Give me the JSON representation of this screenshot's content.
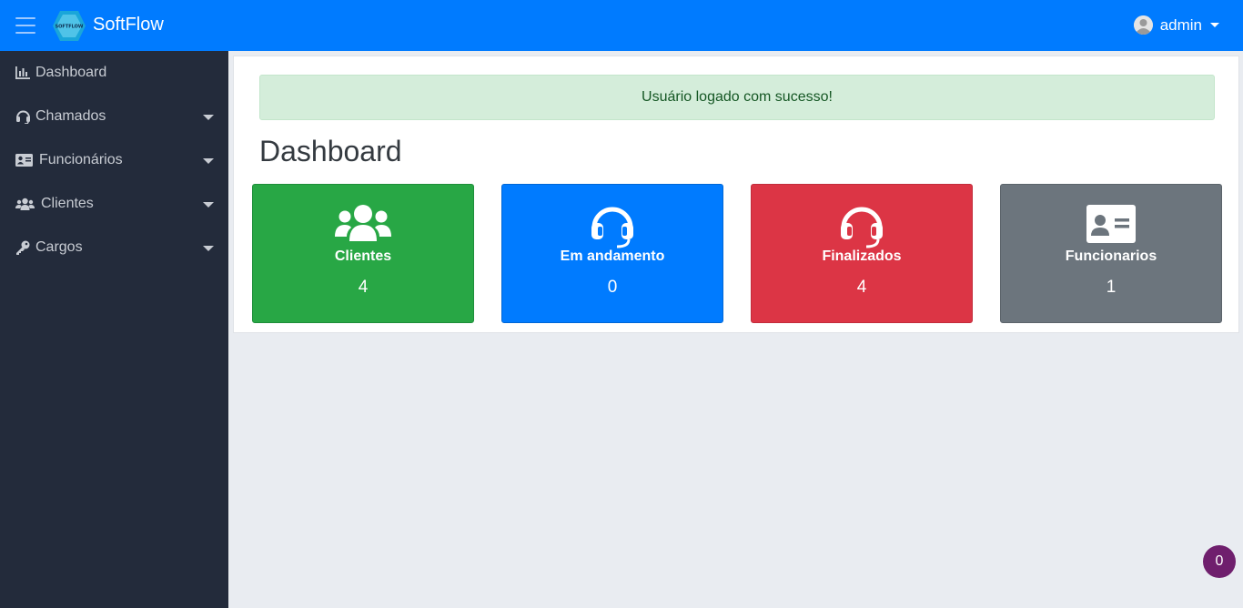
{
  "header": {
    "brand": "SoftFlow",
    "logo_text": "SOFTFLOW",
    "user": "admin"
  },
  "sidebar": {
    "items": [
      {
        "label": "Dashboard",
        "icon": "chart-bar-icon",
        "has_submenu": false
      },
      {
        "label": "Chamados",
        "icon": "headset-icon",
        "has_submenu": true
      },
      {
        "label": "Funcionários",
        "icon": "id-card-icon",
        "has_submenu": true
      },
      {
        "label": "Clientes",
        "icon": "users-icon",
        "has_submenu": true
      },
      {
        "label": "Cargos",
        "icon": "key-icon",
        "has_submenu": true
      }
    ]
  },
  "main": {
    "alert": "Usuário logado com sucesso!",
    "title": "Dashboard",
    "cards": [
      {
        "label": "Clientes",
        "value": "4",
        "icon": "users-icon",
        "color": "#28a745"
      },
      {
        "label": "Em andamento",
        "value": "0",
        "icon": "headset-icon",
        "color": "#007bff"
      },
      {
        "label": "Finalizados",
        "value": "4",
        "icon": "headset-icon",
        "color": "#dc3545"
      },
      {
        "label": "Funcionarios",
        "value": "1",
        "icon": "id-card-icon",
        "color": "#6c757d"
      }
    ]
  },
  "floating_badge": "0",
  "colors": {
    "topbar": "#007bff",
    "sidebar": "#232b3b",
    "alert_bg": "#d4edda",
    "badge": "#6f1f6d"
  }
}
